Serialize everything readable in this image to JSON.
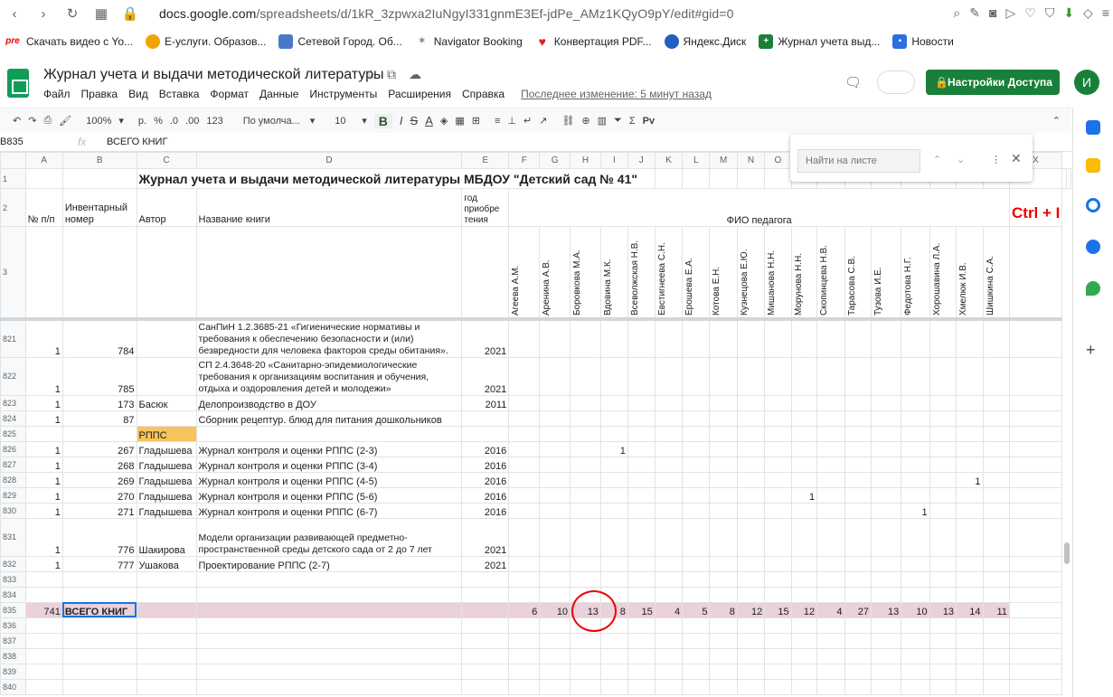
{
  "browser": {
    "url_domain": "docs.google.com",
    "url_path": "/spreadsheets/d/1kR_3zpwxa2IuNgyI331gnmE3Ef-jdPe_AMz1KQyO9pY/edit#gid=0"
  },
  "bookmarks": [
    {
      "label": "Скачать видео с Yo...",
      "icon": "pre-icon"
    },
    {
      "label": "Е-услуги. Образов...",
      "icon": "globe-icon"
    },
    {
      "label": "Сетевой Город. Об...",
      "icon": "school-icon"
    },
    {
      "label": "Navigator Booking",
      "icon": "navigator-icon"
    },
    {
      "label": "Конвертация PDF...",
      "icon": "heart-icon"
    },
    {
      "label": "Яндекс.Диск",
      "icon": "yandex-disk-icon"
    },
    {
      "label": "Журнал учета выд...",
      "icon": "sheets-icon"
    },
    {
      "label": "Новости",
      "icon": "news-icon"
    }
  ],
  "app": {
    "doc_title": "Журнал учета и выдачи методической литературы",
    "share_label": "Настройки Доступа",
    "avatar_letter": "И",
    "menus": [
      "Файл",
      "Правка",
      "Вид",
      "Вставка",
      "Формат",
      "Данные",
      "Инструменты",
      "Расширения",
      "Справка"
    ],
    "last_edit": "Последнее изменение: 5 минут назад"
  },
  "toolbar": {
    "zoom": "100%",
    "currency": "р.",
    "percent": "%",
    "dec_less": ".0",
    "dec_more": ".00",
    "format": "123",
    "font": "По умолча...",
    "size": "10",
    "bold": "B",
    "italic": "I",
    "strike": "S",
    "textcolor": "A",
    "lang": "Рv"
  },
  "formula": {
    "namebox": "B835",
    "fx": "fx",
    "value": "ВСЕГО КНИГ"
  },
  "find": {
    "placeholder": "Найти на листе"
  },
  "hint": "Ctrl + I",
  "columns": [
    "A",
    "B",
    "C",
    "D",
    "E",
    "F",
    "G",
    "H",
    "I",
    "J",
    "K",
    "L",
    "M",
    "N",
    "O",
    "P",
    "Q",
    "R",
    "S",
    "T",
    "U",
    "V",
    "W",
    "X"
  ],
  "header": {
    "title": "Журнал учета и выдачи методической литературы МБДОУ \"Детский сад № 41\"",
    "col_a": "№ п/п",
    "col_b": "Инвентарный номер",
    "col_c": "Автор",
    "col_d": "Название книги",
    "col_e": "год приобре тения",
    "fio": "ФИО педагога",
    "teachers": [
      "Агеева А.М.",
      "Аренина А.В.",
      "Боровкова М.А.",
      "Вдовина М.К.",
      "Всеволжская Н.В.",
      "Евстигнеева С.Н.",
      "Ерошева Е.А.",
      "Котова Е.Н.",
      "Кузнецова Е.Ю.",
      "Мишанова Н.Н.",
      "Морунова Н.Н.",
      "Скопинцева Н.В.",
      "Тарасова С.В.",
      "Тузова И.Е.",
      "Федотова Н.Г.",
      "Хорошавина Л.А.",
      "Хмелюк И.В.",
      "Шишкина С.А."
    ]
  },
  "rows": [
    {
      "n": "821",
      "a": "1",
      "b": "784",
      "c": "",
      "d": "СанПиН 1.2.3685-21 «Гигиенические нормативы и требования к обеспечению безопасности и (или) безвредности для человека факторов среды обитания».",
      "e": "2021",
      "tall": true
    },
    {
      "n": "822",
      "a": "1",
      "b": "785",
      "c": "",
      "d": "СП 2.4.3648-20 «Санитарно-эпидемиологические требования к организациям воспитания и обучения, отдыха и оздоровления детей и молодежи»",
      "e": "2021",
      "tall": true
    },
    {
      "n": "823",
      "a": "1",
      "b": "173",
      "c": "Басюк",
      "d": "Делопроизводство в ДОУ",
      "e": "2011"
    },
    {
      "n": "824",
      "a": "1",
      "b": "87",
      "c": "",
      "d": "Сборник рецептур. блюд для питания дошкольников",
      "e": ""
    },
    {
      "n": "825",
      "a": "",
      "b": "",
      "c": "РППС",
      "d": "",
      "e": "",
      "yellow": true
    },
    {
      "n": "826",
      "a": "1",
      "b": "267",
      "c": "Гладышева",
      "d": "Журнал контроля и оценки РППС (2-3)",
      "e": "2016",
      "mark": {
        "col": 3,
        "v": "1"
      }
    },
    {
      "n": "827",
      "a": "1",
      "b": "268",
      "c": "Гладышева",
      "d": "Журнал контроля и оценки РППС (3-4)",
      "e": "2016"
    },
    {
      "n": "828",
      "a": "1",
      "b": "269",
      "c": "Гладышева",
      "d": "Журнал контроля и оценки РППС (4-5)",
      "e": "2016",
      "mark": {
        "col": 16,
        "v": "1"
      }
    },
    {
      "n": "829",
      "a": "1",
      "b": "270",
      "c": "Гладышева",
      "d": "Журнал контроля и оценки РППС (5-6)",
      "e": "2016",
      "mark": {
        "col": 10,
        "v": "1"
      }
    },
    {
      "n": "830",
      "a": "1",
      "b": "271",
      "c": "Гладышева",
      "d": "Журнал контроля и оценки РППС (6-7)",
      "e": "2016",
      "mark": {
        "col": 14,
        "v": "1"
      }
    },
    {
      "n": "831",
      "a": "1",
      "b": "776",
      "c": "Шакирова",
      "d": "Модели организации развивающей предметно-пространственной среды детского сада от 2 до 7 лет",
      "e": "2021",
      "tall3": true
    },
    {
      "n": "832",
      "a": "1",
      "b": "777",
      "c": "Ушакова",
      "d": "Проектирование РППС (2-7)",
      "e": "2021"
    },
    {
      "n": "833",
      "a": "",
      "b": "",
      "c": "",
      "d": "",
      "e": ""
    },
    {
      "n": "834",
      "a": "",
      "b": "",
      "c": "",
      "d": "",
      "e": ""
    }
  ],
  "total": {
    "n": "835",
    "a": "741",
    "b": "ВСЕГО КНИГ",
    "values": [
      "6",
      "10",
      "13",
      "8",
      "15",
      "4",
      "5",
      "8",
      "12",
      "15",
      "12",
      "4",
      "27",
      "13",
      "10",
      "13",
      "14",
      "11"
    ]
  },
  "empty_rows": [
    "836",
    "837",
    "838",
    "839",
    "840"
  ]
}
